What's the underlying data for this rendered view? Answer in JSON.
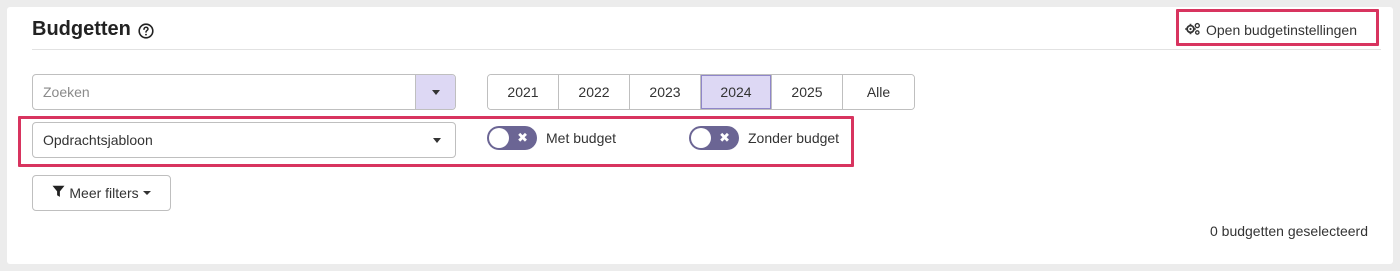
{
  "header": {
    "title": "Budgetten",
    "settings_link": "Open budgetinstellingen"
  },
  "search": {
    "placeholder": "Zoeken",
    "value": ""
  },
  "years": {
    "options": [
      "2021",
      "2022",
      "2023",
      "2024",
      "2025",
      "Alle"
    ],
    "selected": "2024"
  },
  "template_select": {
    "value": "Opdrachtsjabloon"
  },
  "toggles": {
    "with_budget": {
      "label": "Met budget",
      "on": false
    },
    "without_budget": {
      "label": "Zonder budget",
      "on": false
    }
  },
  "filters": {
    "more_label": "Meer filters"
  },
  "footer": {
    "selection_count": "0 budgetten geselecteerd"
  },
  "colors": {
    "highlight": "#d8345f",
    "accent_light": "#ddd8f4",
    "toggle_off": "#6b6594"
  }
}
